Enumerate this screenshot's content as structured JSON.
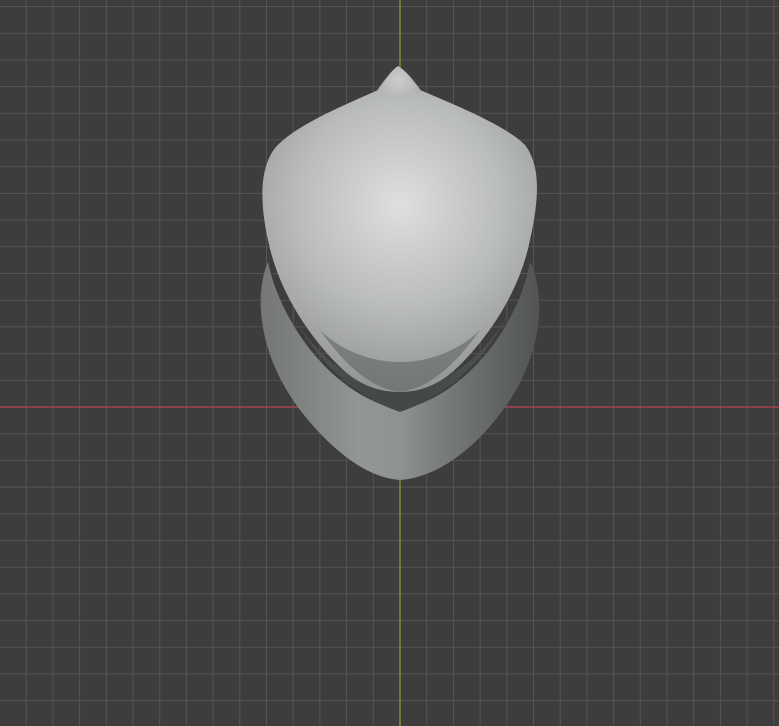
{
  "viewport": {
    "background_color": "#3d3d3d",
    "grid_minor_color": "#4a4a4a",
    "grid_major_color": "#555555",
    "x_axis_color": "#b5464f",
    "y_axis_color": "#8aa13a",
    "grid_visible": true,
    "object": {
      "shading": "solid-clay",
      "base_color": "#8e9190",
      "highlight_color": "#dcdedc",
      "shadow_color": "#4a4e4c"
    }
  }
}
